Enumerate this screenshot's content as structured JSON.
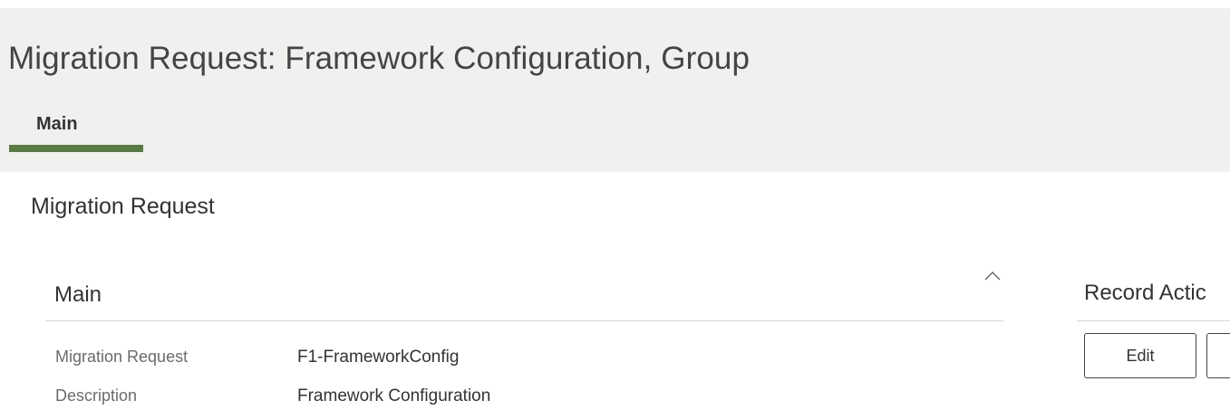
{
  "page": {
    "title": "Migration Request: Framework Configuration, Group"
  },
  "tabs": [
    {
      "label": "Main",
      "active": true
    }
  ],
  "section": {
    "title": "Migration Request"
  },
  "panel": {
    "heading": "Main",
    "toggle_icon": "chevron-up-icon",
    "fields": [
      {
        "label": "Migration Request",
        "value": "F1-FrameworkConfig"
      },
      {
        "label": "Description",
        "value": "Framework Configuration"
      }
    ]
  },
  "record_actions": {
    "title": "Record Actic",
    "buttons": [
      {
        "label": "Edit"
      },
      {
        "label": ""
      }
    ]
  },
  "colors": {
    "header_background": "#f1f0ee",
    "active_tab_indicator": "#5a7a44"
  }
}
